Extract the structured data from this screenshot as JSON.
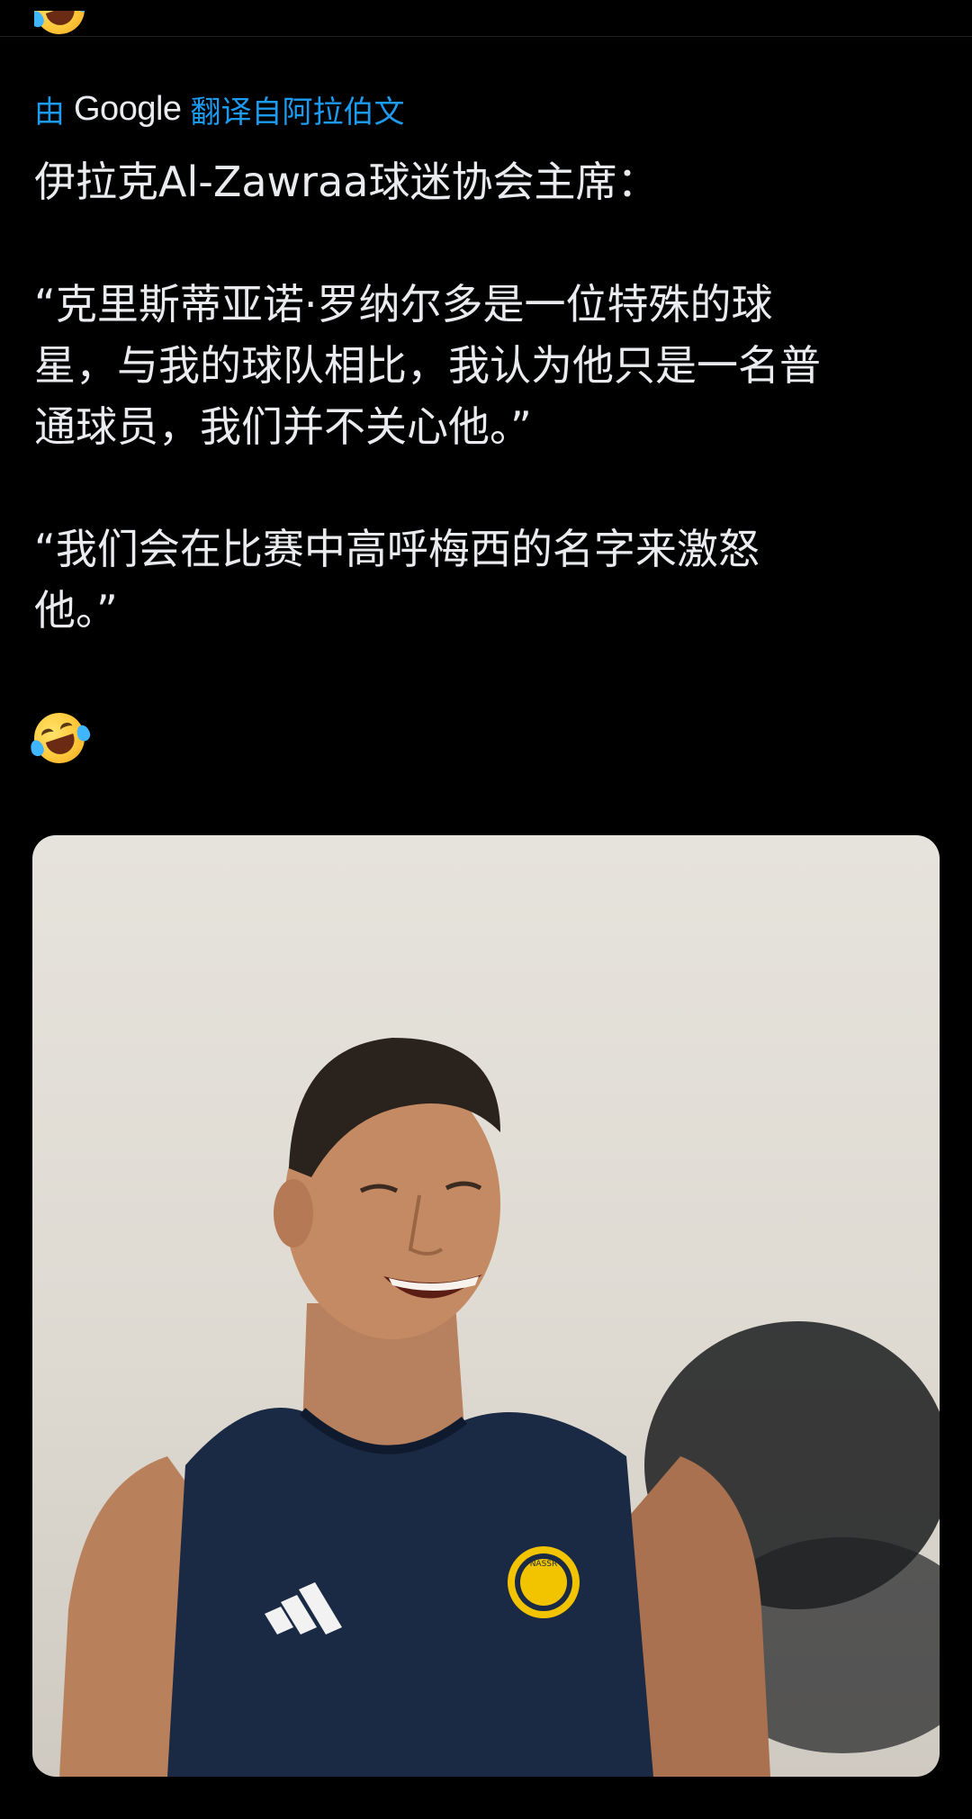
{
  "translation": {
    "prefix": "由",
    "provider": "Google",
    "suffix": "翻译自阿拉伯文"
  },
  "tweet": {
    "lines": [
      "伊拉克Al-Zawraa球迷协会主席：",
      "",
      "“克里斯蒂亚诺·罗纳尔多是一位特殊的球",
      "星，与我的球队相比，我认为他只是一名普",
      "通球员，我们并不关心他。”",
      "",
      "“我们会在比赛中高呼梅西的名字来激怒",
      "他。”"
    ],
    "emoji": "rolling-on-floor-laughing"
  },
  "media": {
    "type": "photo",
    "subject": "laughing-football-player",
    "badge_text": "NASSR"
  },
  "colors": {
    "background": "#000000",
    "text": "#e9ebee",
    "link": "#1d9bf0"
  }
}
